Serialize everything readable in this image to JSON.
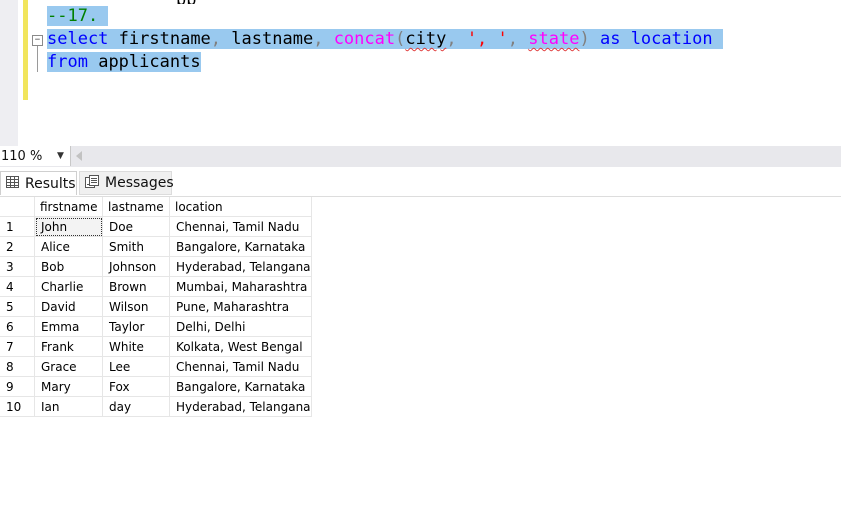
{
  "editor": {
    "top_clipped_text": "pp",
    "comment": "--17.",
    "line2": {
      "kw_select": "select",
      "col1": "firstname",
      "comma1": ",",
      "col2": "lastname",
      "comma2": ",",
      "fn_concat": "concat",
      "paren_open": "(",
      "arg_city": "city",
      "comma3": ",",
      "sep_literal": "', '",
      "comma4": ",",
      "arg_state": "state",
      "paren_close": ")",
      "kw_as": "as",
      "alias": "location"
    },
    "line3": {
      "kw_from": "from",
      "table": "applicants"
    }
  },
  "zoom": {
    "value": "110 %"
  },
  "tabs": [
    {
      "label": "Results",
      "icon": "grid-icon"
    },
    {
      "label": "Messages",
      "icon": "messages-icon"
    }
  ],
  "grid": {
    "columns": [
      "",
      "firstname",
      "lastname",
      "location"
    ],
    "rows": [
      [
        "1",
        "John",
        "Doe",
        "Chennai, Tamil Nadu"
      ],
      [
        "2",
        "Alice",
        "Smith",
        "Bangalore, Karnataka"
      ],
      [
        "3",
        "Bob",
        "Johnson",
        "Hyderabad, Telangana"
      ],
      [
        "4",
        "Charlie",
        "Brown",
        "Mumbai, Maharashtra"
      ],
      [
        "5",
        "David",
        "Wilson",
        "Pune, Maharashtra"
      ],
      [
        "6",
        "Emma",
        "Taylor",
        "Delhi, Delhi"
      ],
      [
        "7",
        "Frank",
        "White",
        "Kolkata, West Bengal"
      ],
      [
        "8",
        "Grace",
        "Lee",
        "Chennai, Tamil Nadu"
      ],
      [
        "9",
        "Mary",
        "Fox",
        "Bangalore, Karnataka"
      ],
      [
        "10",
        "Ian",
        "day",
        "Hyderabad, Telangana"
      ]
    ]
  },
  "colors": {
    "selection": "#99c9ef",
    "keyword": "#0000ff",
    "function": "#ff00ff",
    "string": "#ff0000",
    "comment": "#008000"
  }
}
